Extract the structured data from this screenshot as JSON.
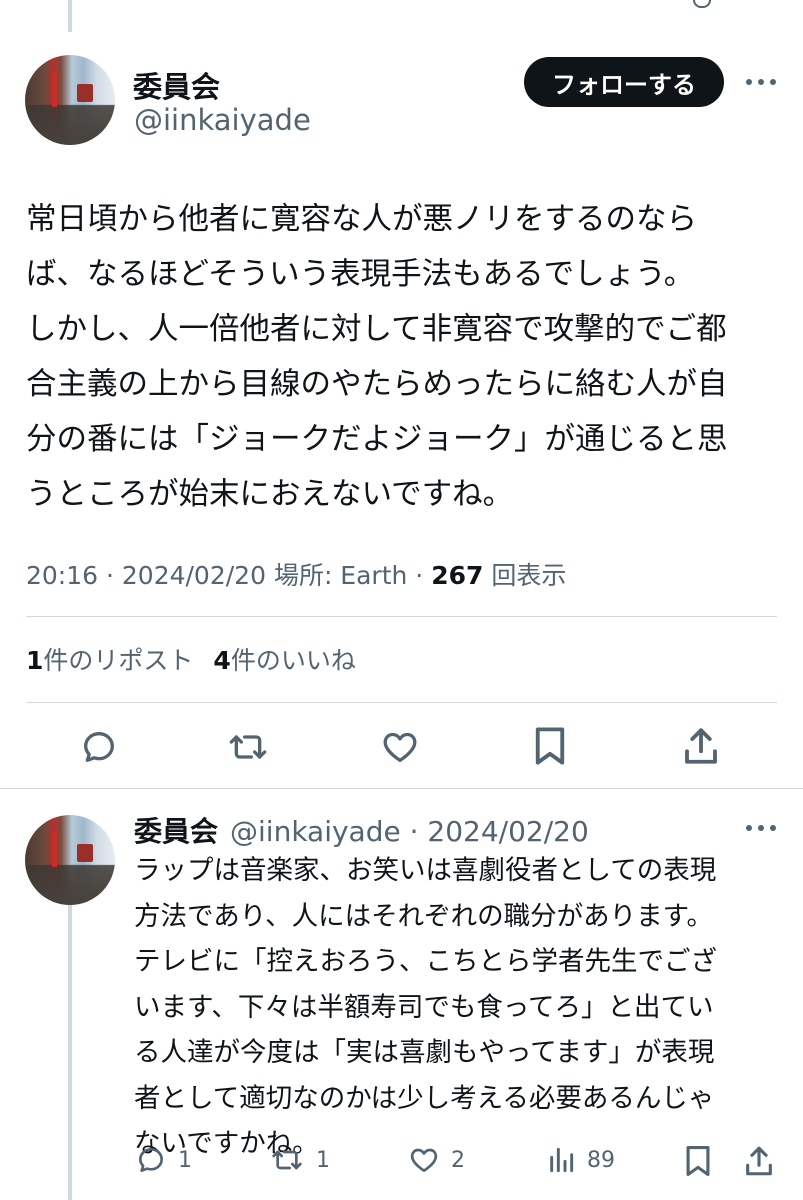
{
  "main_tweet": {
    "display_name": "委員会",
    "handle": "@iinkaiyade",
    "follow_label": "フォローする",
    "body": "常日頃から他者に寛容な人が悪ノリをするのなら\nば、なるほどそういう表現手法もあるでしょう。\nしかし、人一倍他者に対して非寛容で攻撃的でご都\n合主義の上から目線のやたらめったらに絡む人が自\n分の番には「ジョークだよジョーク」が通じると思\nうところが始末におえないですね。",
    "time": "20:16",
    "date": "2024/02/20",
    "location_label": "場所: Earth",
    "views_count": "267",
    "views_label": "回表示",
    "reposts_count": "1",
    "reposts_label": "件のリポスト",
    "likes_count": "4",
    "likes_label": "件のいいね"
  },
  "reply_tweet": {
    "display_name": "委員会",
    "handle_date": "@iinkaiyade · 2024/02/20",
    "body": "ラップは音楽家、お笑いは喜劇役者としての表現\n方法であり、人にはそれぞれの職分があります。\nテレビに「控えおろう、こちとら学者先生でござ\nいます、下々は半額寿司でも食ってろ」と出てい\nる人達が今度は「実は喜劇もやってます」が表現\n者として適切なのかは少し考える必要あるんじゃ\nないですかね。",
    "replies": "1",
    "reposts": "1",
    "likes": "2",
    "views": "89"
  },
  "icons": {
    "reply": "reply-icon",
    "repost": "repost-icon",
    "like": "heart-icon",
    "bookmark": "bookmark-icon",
    "share": "share-icon",
    "views": "analytics-icon",
    "more": "more-icon"
  },
  "colors": {
    "text": "#0f1419",
    "secondary": "#536471",
    "divider": "#cfd9de",
    "follow_bg": "#0f1419"
  }
}
